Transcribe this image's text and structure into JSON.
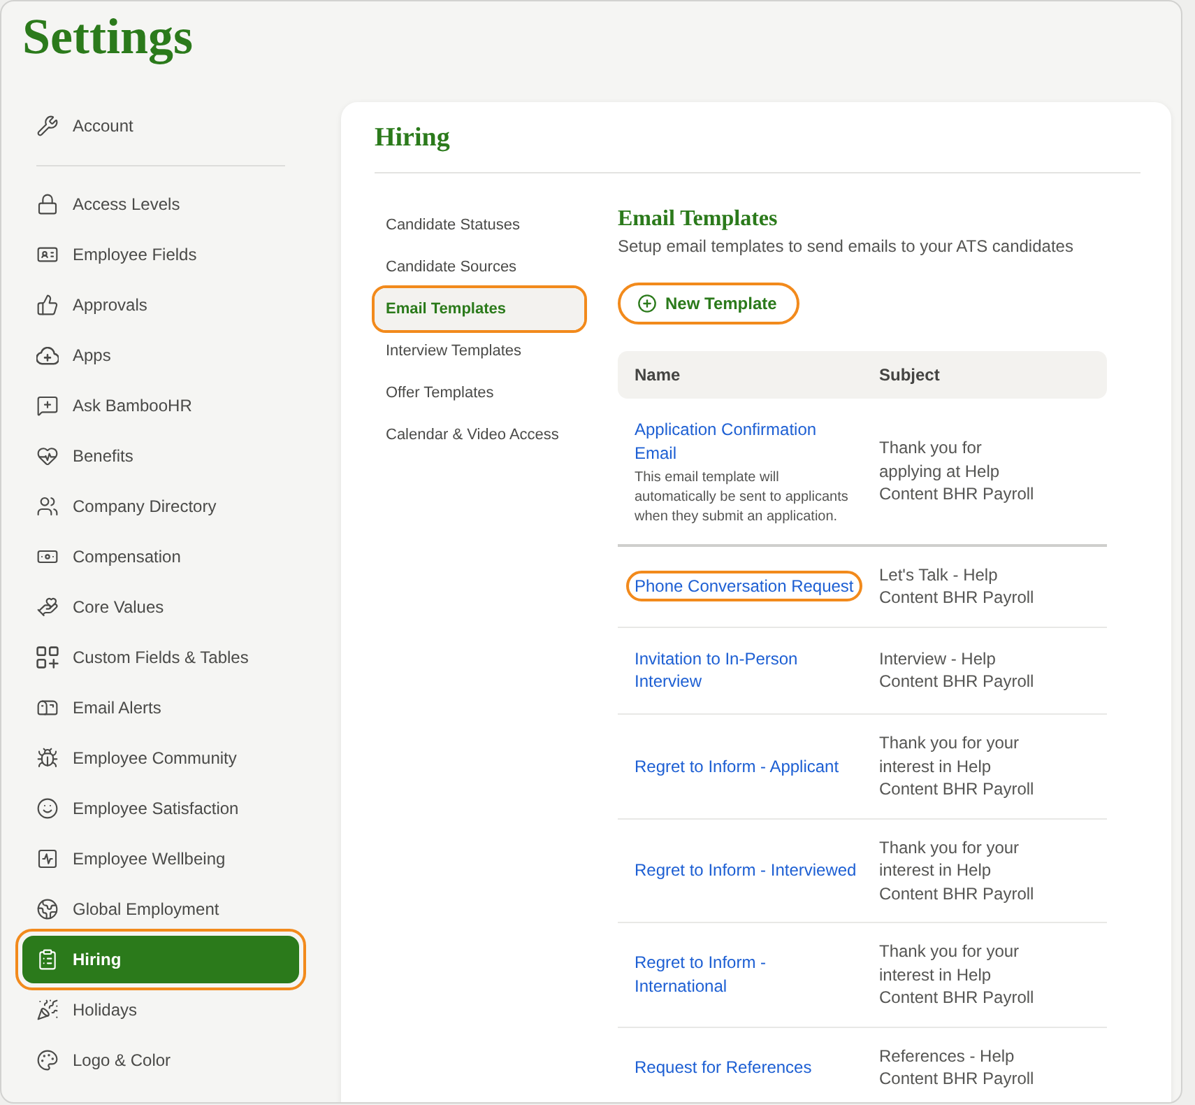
{
  "page": {
    "title": "Settings"
  },
  "sidebar": {
    "sections": [
      {
        "items": [
          {
            "label": "Account",
            "selected": false,
            "highlighted": false
          }
        ]
      },
      {
        "items": [
          {
            "label": "Access Levels",
            "selected": false,
            "highlighted": false
          },
          {
            "label": "Employee Fields",
            "selected": false,
            "highlighted": false
          },
          {
            "label": "Approvals",
            "selected": false,
            "highlighted": false
          },
          {
            "label": "Apps",
            "selected": false,
            "highlighted": false
          },
          {
            "label": "Ask BambooHR",
            "selected": false,
            "highlighted": false
          },
          {
            "label": "Benefits",
            "selected": false,
            "highlighted": false
          },
          {
            "label": "Company Directory",
            "selected": false,
            "highlighted": false
          },
          {
            "label": "Compensation",
            "selected": false,
            "highlighted": false
          },
          {
            "label": "Core Values",
            "selected": false,
            "highlighted": false
          },
          {
            "label": "Custom Fields & Tables",
            "selected": false,
            "highlighted": false
          },
          {
            "label": "Email Alerts",
            "selected": false,
            "highlighted": false
          },
          {
            "label": "Employee Community",
            "selected": false,
            "highlighted": false
          },
          {
            "label": "Employee Satisfaction",
            "selected": false,
            "highlighted": false
          },
          {
            "label": "Employee Wellbeing",
            "selected": false,
            "highlighted": false
          },
          {
            "label": "Global Employment",
            "selected": false,
            "highlighted": false
          },
          {
            "label": "Hiring",
            "selected": true,
            "highlighted": true
          },
          {
            "label": "Holidays",
            "selected": false,
            "highlighted": false
          },
          {
            "label": "Logo & Color",
            "selected": false,
            "highlighted": false
          }
        ]
      }
    ]
  },
  "panel": {
    "title": "Hiring",
    "subnav": [
      {
        "label": "Candidate Statuses",
        "selected": false,
        "highlighted": false
      },
      {
        "label": "Candidate Sources",
        "selected": false,
        "highlighted": false
      },
      {
        "label": "Email Templates",
        "selected": true,
        "highlighted": true
      },
      {
        "label": "Interview Templates",
        "selected": false,
        "highlighted": false
      },
      {
        "label": "Offer Templates",
        "selected": false,
        "highlighted": false
      },
      {
        "label": "Calendar & Video Access",
        "selected": false,
        "highlighted": false
      }
    ],
    "content": {
      "title": "Email Templates",
      "subtitle": "Setup email templates to send emails to your ATS candidates",
      "new_button": {
        "label": "New Template",
        "highlighted": true
      },
      "table": {
        "columns": [
          "Name",
          "Subject"
        ],
        "groups": [
          {
            "rows": [
              {
                "name": "Application Confirmation Email",
                "description": "This email template will automatically be sent to applicants when they submit an application.",
                "subject": "Thank you for applying at Help Content BHR Payroll",
                "highlighted": false
              }
            ]
          },
          {
            "rows": [
              {
                "name": "Phone Conversation Request",
                "subject": "Let's Talk - Help Content BHR Payroll",
                "highlighted": true
              },
              {
                "name": "Invitation to In-Person Interview",
                "subject": "Interview - Help Content BHR Payroll",
                "highlighted": false
              },
              {
                "name": "Regret to Inform - Applicant",
                "subject": "Thank you for your interest in Help Content BHR Payroll",
                "highlighted": false
              },
              {
                "name": "Regret to Inform - Interviewed",
                "subject": "Thank you for your interest in Help Content BHR Payroll",
                "highlighted": false
              },
              {
                "name": "Regret to Inform - International",
                "subject": "Thank you for your interest in Help Content BHR Payroll",
                "highlighted": false
              },
              {
                "name": "Request for References",
                "subject": "References - Help Content BHR Payroll",
                "highlighted": false
              }
            ]
          }
        ]
      }
    }
  }
}
